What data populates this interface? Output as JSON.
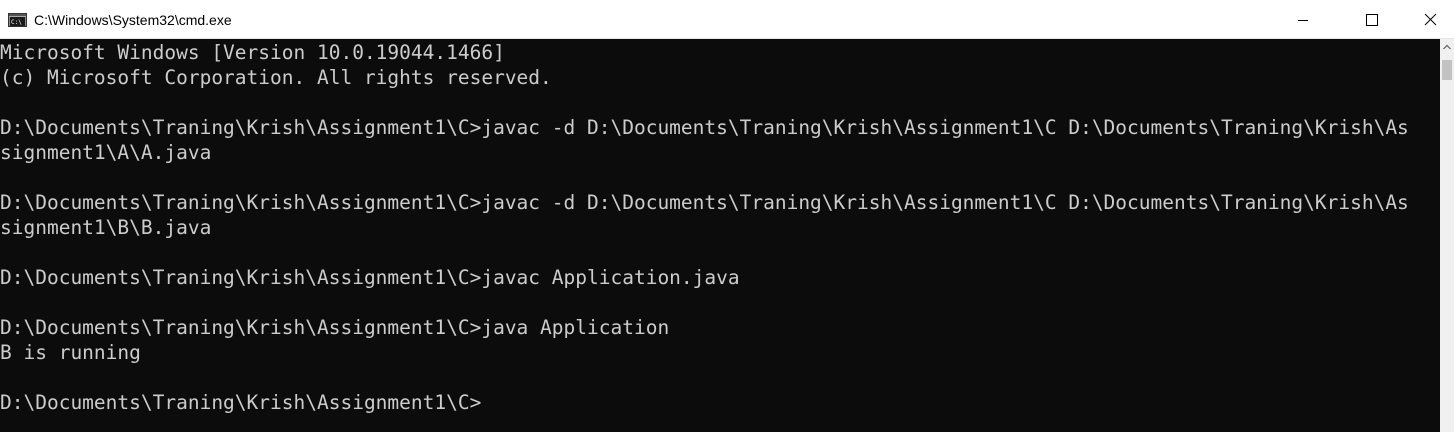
{
  "window": {
    "title": "C:\\Windows\\System32\\cmd.exe",
    "icon": "cmd-app-icon",
    "controls": [
      "minimize-icon",
      "maximize-icon",
      "close-icon"
    ]
  },
  "console": {
    "lines": [
      "Microsoft Windows [Version 10.0.19044.1466]",
      "(c) Microsoft Corporation. All rights reserved.",
      "",
      "D:\\Documents\\Traning\\Krish\\Assignment1\\C>javac -d D:\\Documents\\Traning\\Krish\\Assignment1\\C D:\\Documents\\Traning\\Krish\\As",
      "signment1\\A\\A.java",
      "",
      "D:\\Documents\\Traning\\Krish\\Assignment1\\C>javac -d D:\\Documents\\Traning\\Krish\\Assignment1\\C D:\\Documents\\Traning\\Krish\\As",
      "signment1\\B\\B.java",
      "",
      "D:\\Documents\\Traning\\Krish\\Assignment1\\C>javac Application.java",
      "",
      "D:\\Documents\\Traning\\Krish\\Assignment1\\C>java Application",
      "B is running",
      "",
      "D:\\Documents\\Traning\\Krish\\Assignment1\\C>"
    ]
  },
  "colors": {
    "console_background": "#0c0c0c",
    "console_text": "#cccccc",
    "titlebar_background": "#ffffff"
  }
}
